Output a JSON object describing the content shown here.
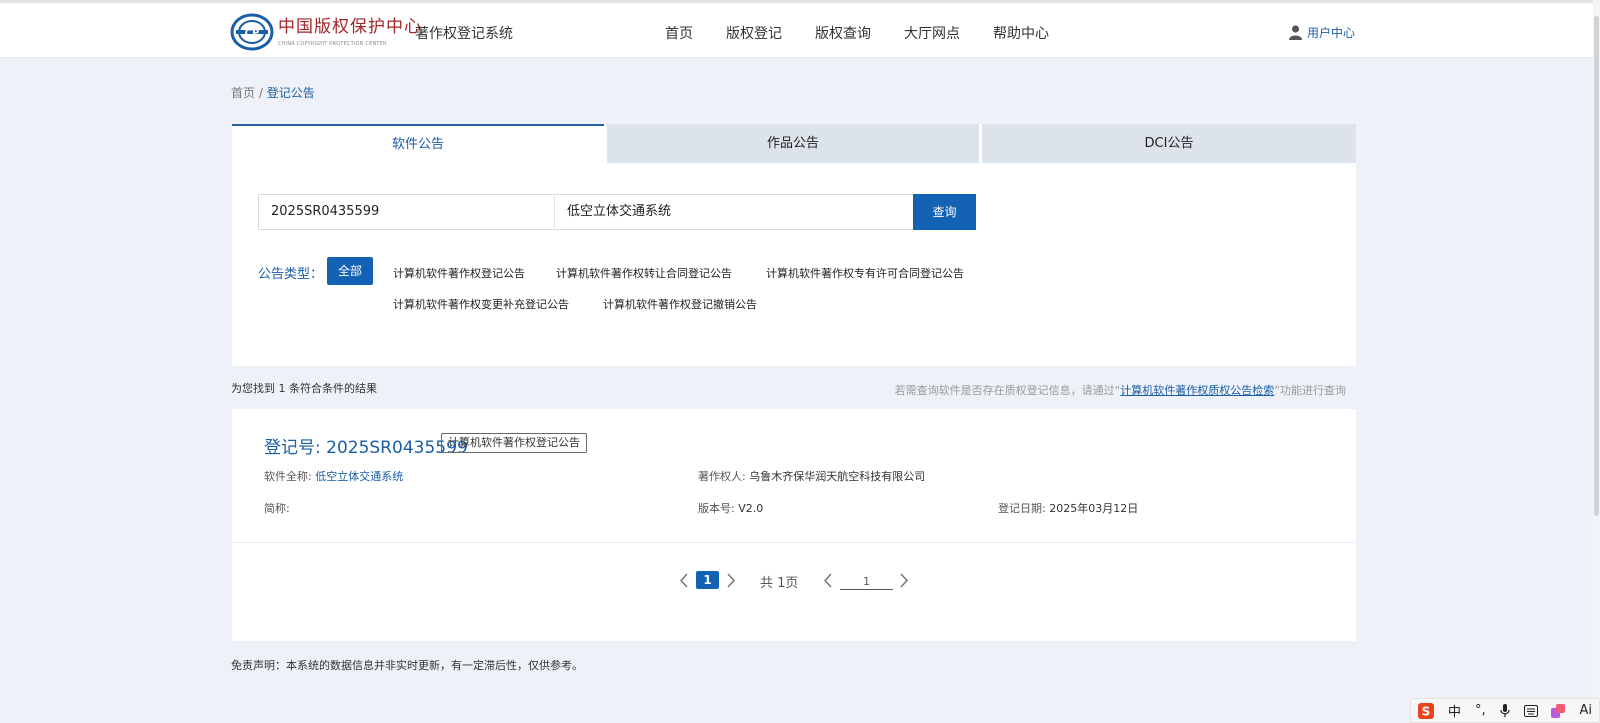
{
  "header": {
    "logo_cn": "中国版权保护中心",
    "logo_en": "CHINA COPYRIGHT PROTECTION CENTER",
    "system_name": "著作权登记系统",
    "nav": [
      "首页",
      "版权登记",
      "版权查询",
      "大厅网点",
      "帮助中心"
    ],
    "user_center": "用户中心"
  },
  "breadcrumb": {
    "home": "首页",
    "separator": " / ",
    "current": "登记公告"
  },
  "tabs": [
    "软件公告",
    "作品公告",
    "DCI公告"
  ],
  "search": {
    "reg_no_value": "2025SR0435599",
    "name_value": "低空立体交通系统",
    "button_label": "查询"
  },
  "filter": {
    "label": "公告类型：",
    "all_label": "全部",
    "options": [
      "计算机软件著作权登记公告",
      "计算机软件著作权转让合同登记公告",
      "计算机软件著作权专有许可合同登记公告",
      "计算机软件著作权变更补充登记公告",
      "计算机软件著作权登记撤销公告"
    ]
  },
  "results": {
    "count_text": "为您找到 1 条符合条件的结果",
    "hint_prefix": "若需查询软件是否存在质权登记信息，请通过“",
    "hint_link": "计算机软件著作权质权公告检索",
    "hint_suffix": "”功能进行查询"
  },
  "record": {
    "reg_no": "登记号: 2025SR0435599",
    "type_badge": "计算机软件著作权登记公告",
    "full_name_label": "软件全称: ",
    "full_name_value": "低空立体交通系统",
    "owner_label": "著作权人: ",
    "owner_value": "乌鲁木齐保华润天航空科技有限公司",
    "short_name_label": "简称:",
    "short_name_value": "",
    "version_label": "版本号: ",
    "version_value": "V2.0",
    "date_label": "登记日期: ",
    "date_value": "2025年03月12日"
  },
  "pagination": {
    "current_page": "1",
    "total_text": "共 1页",
    "jump_value": "1"
  },
  "footer": {
    "disclaimer": "免责声明：本系统的数据信息并非实时更新，有一定滞后性，仅供参考。"
  },
  "ime": {
    "lang": "中",
    "punct": "°,",
    "ai": "Ai"
  },
  "colors": {
    "accent": "#1462b3",
    "link": "#1a5ea6",
    "logo_red": "#a3262a",
    "page_bg": "#eef2f8"
  }
}
